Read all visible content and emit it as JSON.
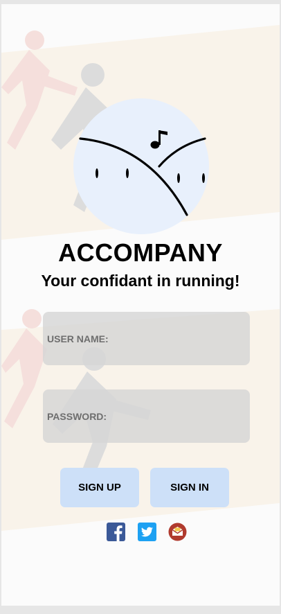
{
  "app": {
    "title": "ACCOMPANY",
    "tagline": "Your confidant in running!"
  },
  "form": {
    "username_label": "USER NAME:",
    "username_value": "",
    "password_label": "PASSWORD:",
    "password_value": ""
  },
  "buttons": {
    "signup_label": "SIGN UP",
    "signin_label": "SIGN IN"
  },
  "social": [
    {
      "icon": "facebook-icon",
      "color": "#3b5998"
    },
    {
      "icon": "twitter-icon",
      "color": "#1da1f2"
    },
    {
      "icon": "mail-icon",
      "color": "#b03a2e"
    }
  ],
  "colors": {
    "logo_circle": "#e8f0fc",
    "button_bg": "#cde0f8",
    "field_bg": "#d6d6d6",
    "field_label": "#6e6e6e"
  }
}
